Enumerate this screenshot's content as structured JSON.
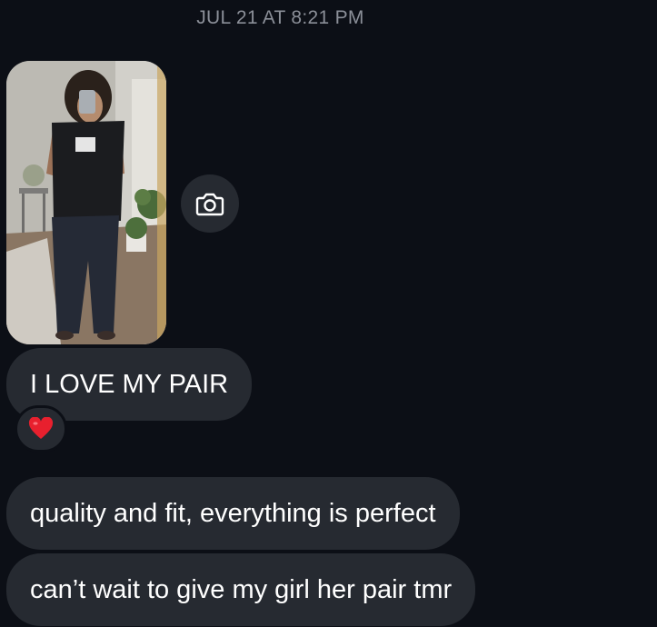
{
  "thread": {
    "timestamp": "JUL 21 AT 8:21 PM"
  },
  "photo": {
    "icon": "photo-message"
  },
  "camera_button": {
    "icon": "camera-icon"
  },
  "messages": [
    {
      "text": "I LOVE MY PAIR",
      "reaction": "heart-icon"
    },
    {
      "text": "quality and fit, everything is perfect"
    },
    {
      "text": "can’t wait to give my girl her pair tmr"
    }
  ],
  "colors": {
    "background": "#0c0f16",
    "bubble": "#262a31",
    "timestamp": "#8b8f98",
    "heart": "#e8202e"
  }
}
